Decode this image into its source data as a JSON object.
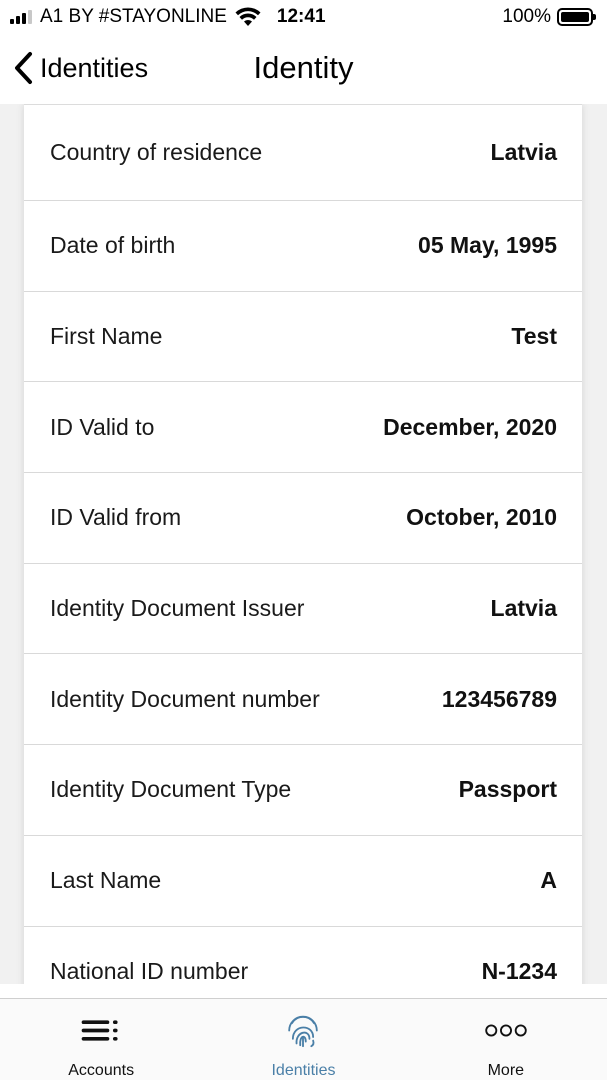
{
  "status_bar": {
    "carrier": "A1 BY #STAYONLINE",
    "time": "12:41",
    "battery": "100%"
  },
  "nav": {
    "back_label": "Identities",
    "title": "Identity"
  },
  "rows": [
    {
      "label": "Country of residence",
      "value": "Latvia"
    },
    {
      "label": "Date of birth",
      "value": "05 May, 1995"
    },
    {
      "label": "First Name",
      "value": "Test"
    },
    {
      "label": "ID Valid to",
      "value": "December, 2020"
    },
    {
      "label": "ID Valid from",
      "value": "October, 2010"
    },
    {
      "label": "Identity Document Issuer",
      "value": "Latvia"
    },
    {
      "label": "Identity Document number",
      "value": "123456789"
    },
    {
      "label": "Identity Document Type",
      "value": "Passport"
    },
    {
      "label": "Last Name",
      "value": "A"
    },
    {
      "label": "National ID number",
      "value": "N-1234"
    }
  ],
  "tabs": [
    {
      "label": "Accounts",
      "icon": "menu-icon",
      "active": false
    },
    {
      "label": "Identities",
      "icon": "fingerprint-icon",
      "active": true
    },
    {
      "label": "More",
      "icon": "more-dots-icon",
      "active": false
    }
  ],
  "colors": {
    "active_tab": "#4a7fa7",
    "background": "#f1f1f1"
  }
}
